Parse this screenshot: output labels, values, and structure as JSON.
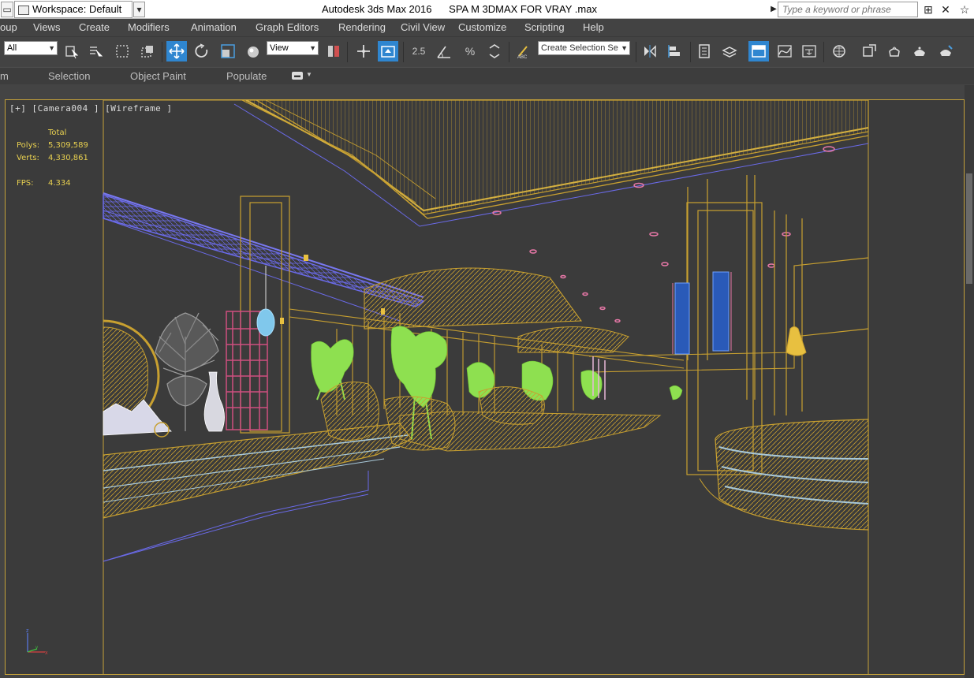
{
  "titlebar": {
    "workspace_label": "Workspace: Default",
    "title": "Autodesk 3ds Max 2016      SPA M 3DMAX FOR VRAY .max",
    "search_placeholder": "Type a keyword or phrase"
  },
  "menu": {
    "items": [
      "oup",
      "Views",
      "Create",
      "Modifiers",
      "Animation",
      "Graph Editors",
      "Rendering",
      "Civil View",
      "Customize",
      "Scripting",
      "Help"
    ]
  },
  "toolbar": {
    "filter_value": "All",
    "refcoord_value": "View",
    "snap_angle_label": "2.5",
    "selection_set_placeholder": "Create Selection Se"
  },
  "ribbon": {
    "tabs": [
      "m",
      "Selection",
      "Object Paint",
      "Populate"
    ]
  },
  "viewport": {
    "label": "[+] [Camera004 ] [Wireframe ]",
    "stats": {
      "header": "Total",
      "polys_label": "Polys:",
      "polys_value": "5,309,589",
      "verts_label": "Verts:",
      "verts_value": "4,330,861",
      "fps_label": "FPS:",
      "fps_value": "4.334"
    },
    "wire_color_primary": "#c8a030",
    "wire_color_secondary": "#6a6ae8",
    "plant_color": "#8ee050"
  },
  "icons": {
    "max_app": "app-icon",
    "workspace": "workspace-icon",
    "dropdown_arrow": "chevron-down-icon",
    "binoculars": "binoculars-icon",
    "x_tool": "x-tool-icon",
    "star": "star-icon"
  }
}
